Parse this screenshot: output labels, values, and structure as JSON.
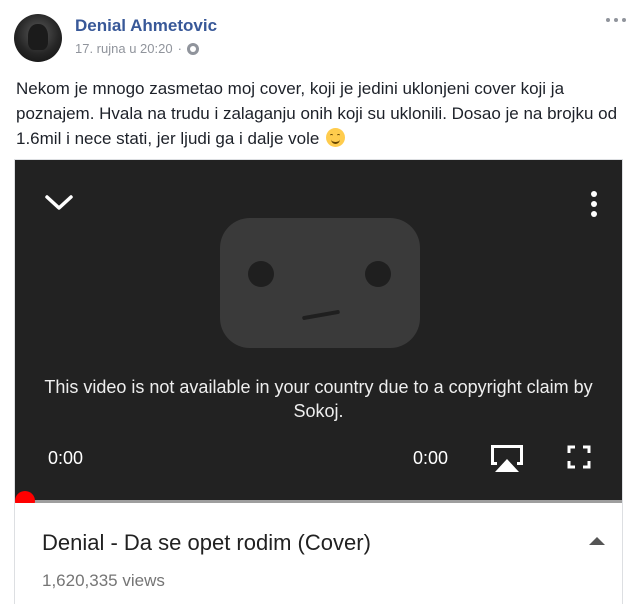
{
  "post": {
    "author": "Denial Ahmetovic",
    "date": "17. rujna u 20:20",
    "separator": "·",
    "privacy_icon": "globe-icon",
    "more_icon": "more-horizontal-icon",
    "text": "Nekom je mnogo zasmetao moj cover, koji je jedini uklonjeni cover koji ja poznajem. Hvala na trudu i zalaganju onih koji su uklonili. Dosao je na brojku od 1.6mil i nece stati, jer ljudi ga i dalje vole",
    "emoji": "smiling-face-emoji"
  },
  "video": {
    "unavailable_message": "This video is not available in your country due to a copyright claim by Sokoj.",
    "current_time": "0:00",
    "duration": "0:00",
    "progress": 0,
    "title": "Denial - Da se opet rodim (Cover)",
    "views": "1,620,335 views",
    "colors": {
      "player_bg": "#222222",
      "progress_dot": "#ff0000",
      "author_link": "#385898"
    }
  }
}
